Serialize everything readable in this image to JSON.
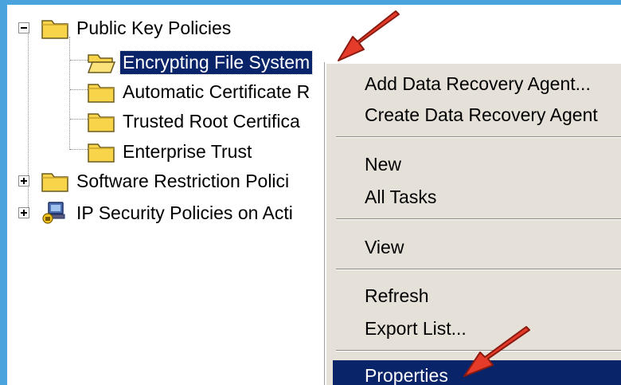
{
  "tree": {
    "items": [
      {
        "label": "Public Key Policies",
        "expander": "minus",
        "icon": "folder-icon"
      },
      {
        "label": "Encrypting File System",
        "icon": "open-folder-icon",
        "selected": true
      },
      {
        "label": "Automatic Certificate R",
        "icon": "folder-icon"
      },
      {
        "label": "Trusted Root Certifica",
        "icon": "folder-icon"
      },
      {
        "label": "Enterprise Trust",
        "icon": "folder-icon"
      },
      {
        "label": "Software Restriction Polici",
        "expander": "plus",
        "icon": "folder-icon"
      },
      {
        "label": "IP Security Policies on Acti",
        "expander": "plus",
        "icon": "ip-security-policy-icon"
      }
    ]
  },
  "context_menu": {
    "items": [
      {
        "label": "Add Data Recovery Agent..."
      },
      {
        "label": "Create Data Recovery Agent"
      },
      {
        "label": "New"
      },
      {
        "label": "All Tasks"
      },
      {
        "label": "View"
      },
      {
        "label": "Refresh"
      },
      {
        "label": "Export List..."
      },
      {
        "label": "Properties",
        "selected": true
      }
    ]
  },
  "colors": {
    "selection": "#0a246a",
    "menu_background": "#e5e1d9",
    "folder": "#f7d44a",
    "arrow": "#e53b2a",
    "border": "#4aa3dc"
  },
  "annotations": [
    {
      "icon": "red-arrow-icon",
      "points_to": "Encrypting File System"
    },
    {
      "icon": "red-arrow-icon",
      "points_to": "Properties"
    }
  ]
}
